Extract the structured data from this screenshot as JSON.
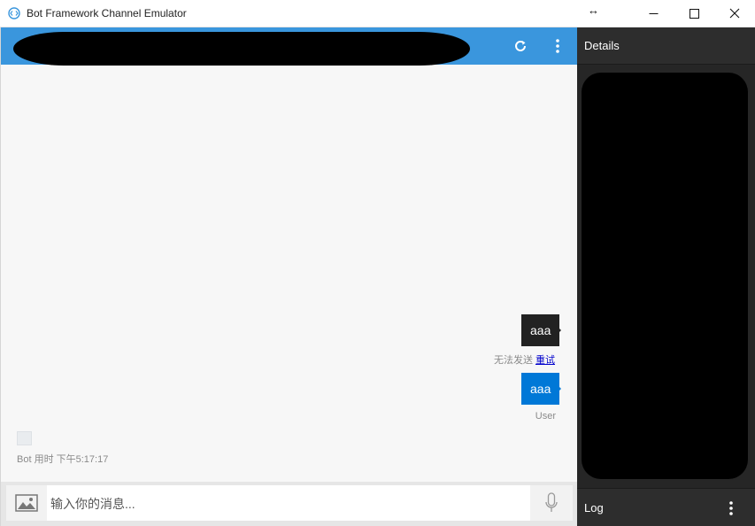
{
  "window": {
    "title": "Bot Framework Channel Emulator",
    "app_icon": "bot-emulator-icon",
    "controls": [
      "minimize-icon",
      "maximize-icon",
      "close-icon"
    ],
    "resize_indicator": "↔"
  },
  "chat": {
    "header_icons": [
      "refresh-icon",
      "more-vertical-icon"
    ],
    "messages": [
      {
        "from": "user",
        "text": "aaa",
        "status_text": "无法发送",
        "retry_label": "重试",
        "bubble_color": "#222222"
      },
      {
        "from": "user",
        "text": "aaa",
        "sender_label": "User",
        "bubble_color": "#0078d7"
      }
    ],
    "bot_message": {
      "meta": "Bot 用时 下午5:17:17"
    },
    "input": {
      "placeholder": "输入你的消息...",
      "value": ""
    },
    "input_icons": [
      "image-upload-icon",
      "microphone-icon"
    ]
  },
  "sidebar": {
    "details_title": "Details",
    "log_title": "Log",
    "log_icon": "more-vertical-icon"
  },
  "colors": {
    "header_blue": "#3a96dd",
    "user_bubble_blue": "#0078d7",
    "failed_bubble": "#222222",
    "panel_dark": "#262626"
  }
}
